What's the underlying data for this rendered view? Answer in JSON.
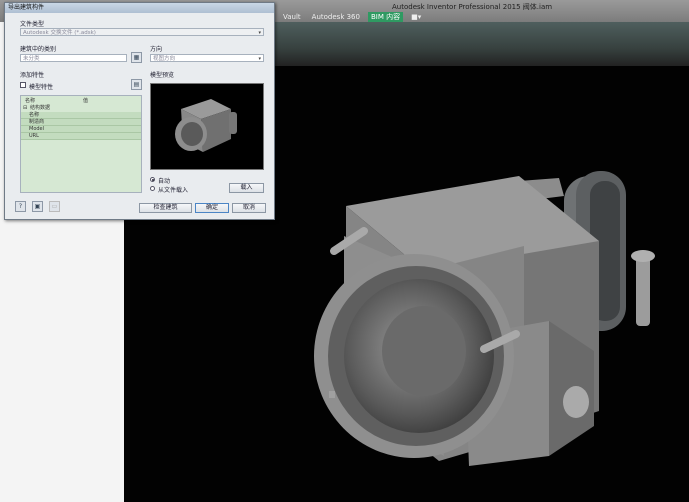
{
  "inventor": {
    "title": "Autodesk Inventor Professional 2015    阀体.iam",
    "tabs": [
      {
        "label": "Vault"
      },
      {
        "label": "Autodesk 360"
      },
      {
        "label": "BIM 内容"
      },
      {
        "label": "■▾"
      }
    ]
  },
  "dialog": {
    "title": "导出建筑构件",
    "file_type_label": "文件类型",
    "file_type_value": "Autodesk 交换文件 (*.adsk)",
    "category_label": "建筑中的类别",
    "category_value": "未分类",
    "direction_label": "方向",
    "direction_value": "视图方向",
    "add_props_label": "添加特性",
    "show_props_label": "模型特性",
    "preview_label": "模型预览",
    "table": {
      "col_name": "名称",
      "col_value": "值",
      "group": "结构数据",
      "rows": [
        "名称",
        "制造商",
        "Model",
        "URL"
      ]
    },
    "radio_auto": "自动",
    "radio_file": "从文件载入",
    "browse_button": "载入",
    "update_button": "检查建筑",
    "ok_button": "确定",
    "cancel_button": "取消"
  },
  "colors": {
    "bim_tab": "#2f9a62",
    "table_bg": "#d6e8d3",
    "viewport_bg": "#020202"
  }
}
